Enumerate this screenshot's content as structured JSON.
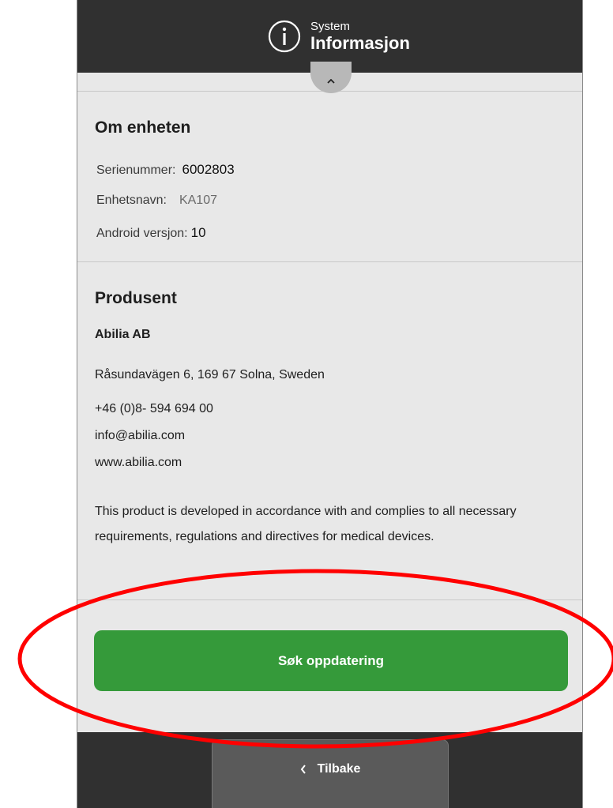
{
  "header": {
    "subtitle": "System",
    "title": "Informasjon",
    "icon": "info-icon"
  },
  "collapse": {
    "icon": "chevron-up-icon"
  },
  "about_device": {
    "title": "Om enheten",
    "serial_label": "Serienummer:",
    "serial_value": "6002803",
    "name_label": "Enhetsnavn:",
    "name_value": "KA107",
    "android_label": "Android versjon:",
    "android_value": "10"
  },
  "manufacturer": {
    "title": "Produsent",
    "company": "Abilia AB",
    "address": "Råsundavägen 6, 169 67 Solna, Sweden",
    "phone": "+46 (0)8- 594 694 00",
    "email": "info@abilia.com",
    "website": "www.abilia.com",
    "compliance_text": "This product is developed in accordance with and complies to all necessary requirements, regulations and directives for medical devices."
  },
  "update_button": {
    "label": "Søk oppdatering",
    "color": "#359a3a"
  },
  "footer": {
    "back_label": "Tilbake",
    "back_icon": "chevron-left-icon"
  },
  "colors": {
    "bar": "#303030",
    "background": "#e8e8e8",
    "annotation": "#ff0000"
  }
}
